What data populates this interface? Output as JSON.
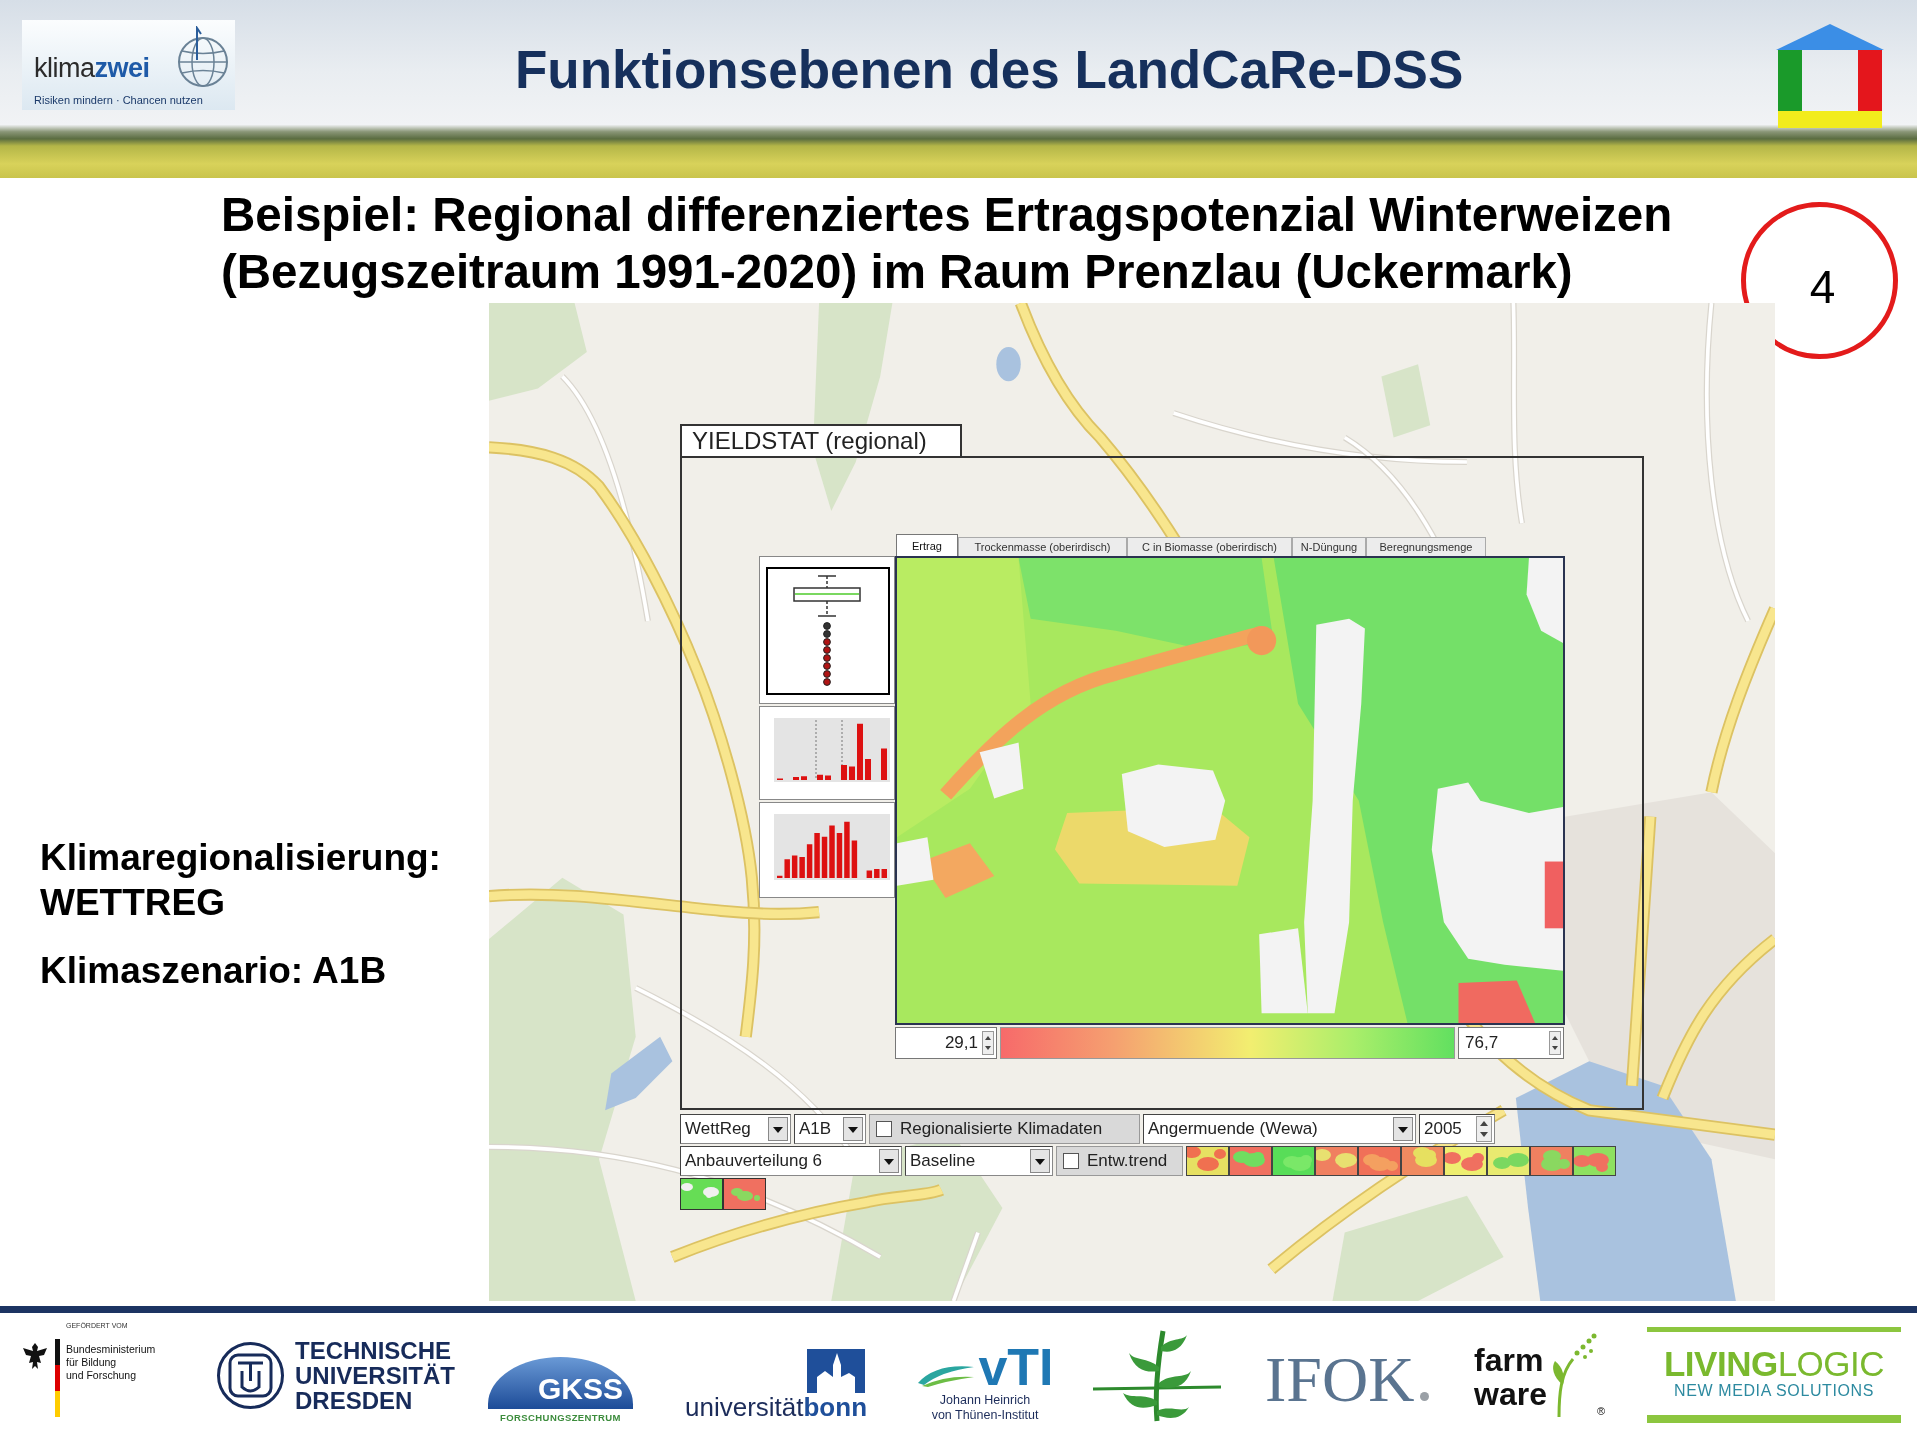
{
  "header": {
    "logo": {
      "wordmark": "klima**zwei**",
      "tagline": "Risiken mindern · Chancen nutzen"
    },
    "title": "Funktionsebenen des LandCaRe-DSS"
  },
  "subtitle": [
    "Beispiel: Regional differenziertes Ertragspotenzial Winterweizen",
    "(Bezugszeitraum 1991-2020) im Raum Prenzlau (Uckermark)"
  ],
  "slide_number": "4",
  "notes": [
    "Klimaregionalisierung: WETTREG",
    "Klimaszenario: A1B"
  ],
  "yieldstat": {
    "title": "YIELDSTAT (regional)",
    "tabs": [
      {
        "label": "Ertrag",
        "selected": true
      },
      {
        "label": "Trockenmasse (oberirdisch)",
        "selected": false
      },
      {
        "label": "C in Biomasse (oberirdisch)",
        "selected": false
      },
      {
        "label": "N-Düngung",
        "selected": false
      },
      {
        "label": "Beregnungsmenge",
        "selected": false
      }
    ],
    "legend": {
      "min": "29,1",
      "max": "76,7"
    },
    "control_rows": [
      [
        {
          "kind": "dropdown",
          "value": "WettReg"
        },
        {
          "kind": "dropdown",
          "value": "A1B"
        },
        {
          "kind": "checkbox",
          "label": "Regionalisierte Klimadaten",
          "checked": false
        },
        {
          "kind": "dropdown",
          "value": "Angermuende (Wewa)"
        },
        {
          "kind": "spinbox",
          "value": "2005"
        }
      ],
      [
        {
          "kind": "dropdown",
          "value": "Anbauverteilung 6"
        },
        {
          "kind": "dropdown",
          "value": "Baseline"
        },
        {
          "kind": "checkbox",
          "label": "Entw.trend",
          "checked": false
        }
      ]
    ]
  },
  "footer": {
    "bmbf": {
      "caption": "GEFÖRDERT VOM",
      "name_lines": [
        "Bundesministerium",
        "für Bildung",
        "und Forschung"
      ]
    },
    "tu_dresden": [
      "TECHNISCHE",
      "UNIVERSITÄT",
      "DRESDEN"
    ],
    "gkss": {
      "name": "GKSS",
      "subtitle": "FORSCHUNGSZENTRUM"
    },
    "bonn": "universität**bonn**",
    "vti": {
      "name": "vTI",
      "subtitle_lines": [
        "Johann Heinrich",
        "von Thünen-Institut"
      ]
    },
    "ifok": "IFOK",
    "farmware": {
      "lines": [
        "farm",
        "ware"
      ],
      "mark": "®"
    },
    "livinglogic": {
      "name": "**LIVING**LOGIC",
      "subtitle": "NEW MEDIA SOLUTIONS"
    }
  }
}
